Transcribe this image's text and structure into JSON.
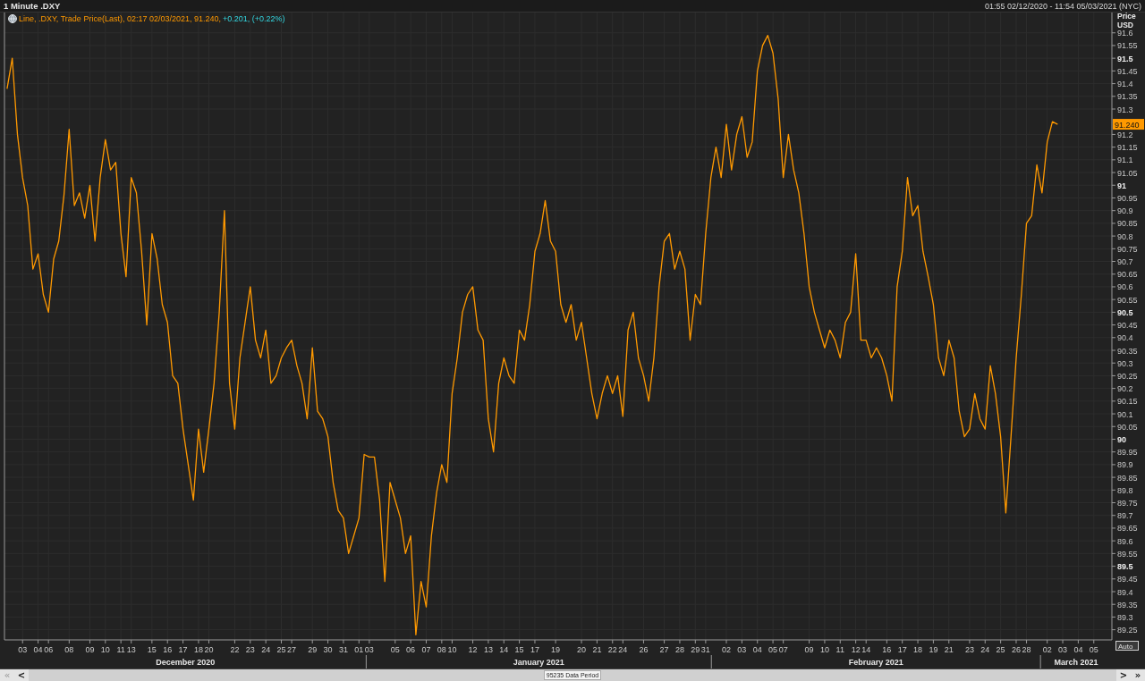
{
  "window": {
    "title": "1 Minute .DXY",
    "date_range": "01:55 02/12/2020 - 11:54 05/03/2021 (NYC)"
  },
  "chart": {
    "legend": {
      "text": "Line, .DXY, Trade Price(Last), 02:17 02/03/2021, 91.240,",
      "change": "+0.201, (+0.22%)"
    },
    "axis_title": [
      "Price",
      "USD"
    ],
    "last_price": {
      "label": "91.240"
    },
    "auto_button": "Auto",
    "months": [
      {
        "label": "December 2020"
      },
      {
        "label": "January 2021"
      },
      {
        "label": "February 2021"
      },
      {
        "label": "March 2021"
      }
    ],
    "chart_data": {
      "type": "line",
      "grid": true,
      "ylim": [
        89.21,
        91.68
      ],
      "categories": [
        null,
        null,
        null,
        "03",
        null,
        null,
        "04",
        null,
        "06",
        null,
        null,
        null,
        "08",
        null,
        null,
        null,
        "09",
        null,
        null,
        "10",
        null,
        null,
        "11",
        null,
        "13",
        null,
        null,
        null,
        "15",
        null,
        null,
        "16",
        null,
        null,
        "17",
        null,
        null,
        "18",
        null,
        "20",
        null,
        null,
        null,
        null,
        "22",
        null,
        null,
        "23",
        null,
        null,
        "24",
        null,
        null,
        "25",
        null,
        "27",
        null,
        null,
        null,
        "29",
        null,
        null,
        "30",
        null,
        null,
        "31",
        null,
        null,
        "01",
        null,
        "03",
        null,
        null,
        null,
        null,
        "05",
        null,
        null,
        "06",
        null,
        null,
        "07",
        null,
        null,
        "08",
        null,
        "10",
        null,
        null,
        null,
        "12",
        null,
        null,
        "13",
        null,
        null,
        "14",
        null,
        null,
        "15",
        null,
        null,
        "17",
        null,
        null,
        null,
        "19",
        null,
        null,
        null,
        null,
        "20",
        null,
        null,
        "21",
        null,
        null,
        "22",
        null,
        "24",
        null,
        null,
        null,
        "26",
        null,
        null,
        null,
        "27",
        null,
        null,
        "28",
        null,
        null,
        "29",
        null,
        "31",
        null,
        null,
        null,
        "02",
        null,
        null,
        "03",
        null,
        null,
        "04",
        null,
        null,
        "05",
        null,
        "07",
        null,
        null,
        null,
        null,
        "09",
        null,
        null,
        "10",
        null,
        null,
        "11",
        null,
        null,
        "12",
        null,
        "14",
        null,
        null,
        null,
        "16",
        null,
        null,
        "17",
        null,
        null,
        "18",
        null,
        null,
        "19",
        null,
        null,
        "21",
        null,
        null,
        null,
        "23",
        null,
        null,
        "24",
        null,
        null,
        "25",
        null,
        null,
        "26",
        null,
        "28",
        null,
        null,
        null,
        "02",
        null,
        null,
        "03",
        null,
        null,
        "04",
        null,
        null,
        "05",
        null,
        null,
        null
      ],
      "series": [
        {
          "color": "#ff9900",
          "values": [
            91.38,
            91.5,
            91.2,
            91.03,
            90.92,
            90.67,
            90.73,
            90.57,
            90.5,
            90.71,
            90.78,
            90.96,
            91.22,
            90.92,
            90.97,
            90.87,
            91.0,
            90.78,
            91.03,
            91.18,
            91.06,
            91.09,
            90.81,
            90.64,
            91.03,
            90.97,
            90.74,
            90.45,
            90.81,
            90.71,
            90.53,
            90.46,
            90.25,
            90.22,
            90.04,
            89.9,
            89.76,
            90.04,
            89.87,
            90.04,
            90.22,
            90.5,
            90.9,
            90.22,
            90.04,
            90.32,
            90.46,
            90.6,
            90.39,
            90.32,
            90.43,
            90.22,
            90.25,
            90.32,
            90.36,
            90.39,
            90.29,
            90.22,
            90.08,
            90.36,
            90.11,
            90.08,
            90.01,
            89.83,
            89.72,
            89.69,
            89.55,
            89.62,
            89.69,
            89.94,
            89.93,
            89.93,
            89.76,
            89.44,
            89.83,
            89.76,
            89.69,
            89.55,
            89.62,
            89.23,
            89.44,
            89.34,
            89.62,
            89.79,
            89.9,
            89.83,
            90.18,
            90.32,
            90.5,
            90.57,
            90.6,
            90.43,
            90.39,
            90.08,
            89.95,
            90.22,
            90.32,
            90.25,
            90.22,
            90.43,
            90.39,
            90.53,
            90.74,
            90.81,
            90.94,
            90.78,
            90.74,
            90.53,
            90.46,
            90.53,
            90.39,
            90.46,
            90.32,
            90.18,
            90.08,
            90.18,
            90.25,
            90.18,
            90.25,
            90.09,
            90.43,
            90.5,
            90.32,
            90.25,
            90.15,
            90.32,
            90.6,
            90.78,
            90.81,
            90.67,
            90.74,
            90.67,
            90.39,
            90.57,
            90.53,
            90.81,
            91.03,
            91.15,
            91.03,
            91.24,
            91.06,
            91.2,
            91.27,
            91.11,
            91.17,
            91.45,
            91.55,
            91.59,
            91.52,
            91.34,
            91.03,
            91.2,
            91.06,
            90.97,
            90.81,
            90.6,
            90.5,
            90.43,
            90.36,
            90.43,
            90.39,
            90.32,
            90.46,
            90.5,
            90.73,
            90.39,
            90.39,
            90.32,
            90.36,
            90.32,
            90.25,
            90.15,
            90.6,
            90.74,
            91.03,
            90.88,
            90.92,
            90.74,
            90.64,
            90.53,
            90.32,
            90.25,
            90.39,
            90.32,
            90.11,
            90.01,
            90.04,
            90.18,
            90.08,
            90.04,
            90.29,
            90.18,
            90.01,
            89.71,
            90.01,
            90.32,
            90.57,
            90.85,
            90.88,
            91.08,
            90.97,
            91.17,
            91.25,
            91.24,
            null,
            null,
            null,
            null,
            null,
            null,
            null,
            null,
            null,
            null
          ]
        }
      ],
      "yticks": [
        91.6,
        91.55,
        91.5,
        91.45,
        91.4,
        91.35,
        91.3,
        91.2,
        91.15,
        91.1,
        91.05,
        91,
        90.95,
        90.9,
        90.85,
        90.8,
        90.75,
        90.7,
        90.65,
        90.6,
        90.55,
        90.5,
        90.45,
        90.4,
        90.35,
        90.3,
        90.25,
        90.2,
        90.15,
        90.1,
        90.05,
        90,
        89.95,
        89.9,
        89.85,
        89.8,
        89.75,
        89.7,
        89.65,
        89.6,
        89.55,
        89.5,
        89.45,
        89.4,
        89.35,
        89.3,
        89.25
      ]
    }
  },
  "scrollbar": {
    "left_buttons": [
      {
        "label": "«",
        "disabled": true
      },
      {
        "label": "<",
        "disabled": false
      }
    ],
    "label": "95235 Data Period",
    "right_buttons": [
      {
        "label": ">",
        "disabled": false
      },
      {
        "label": "»",
        "disabled": false
      }
    ]
  }
}
